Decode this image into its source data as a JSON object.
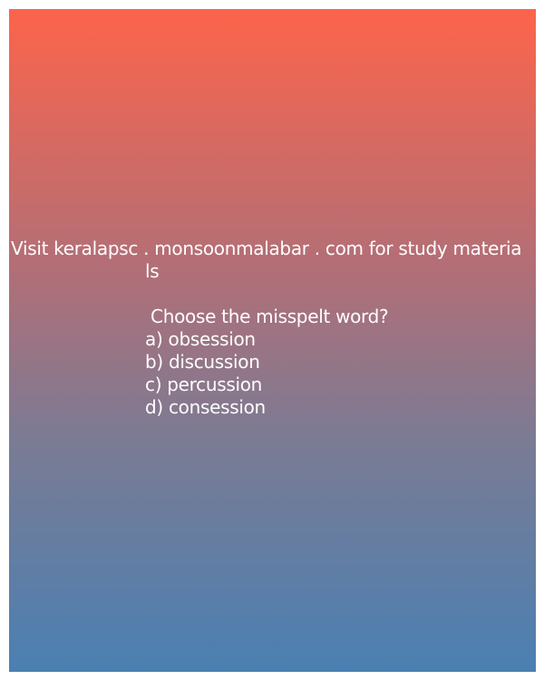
{
  "promo": {
    "line1": "Visit keralapsc . monsoonmalabar . com for study materia",
    "line2": "ls"
  },
  "question": " Choose the misspelt word?",
  "options": [
    "a) obsession",
    "b) discussion",
    "c) percussion",
    "d) consession"
  ],
  "colors": {
    "gradient_top": "#fd644b",
    "gradient_bottom": "#4a80b2",
    "text": "#ffffff"
  }
}
